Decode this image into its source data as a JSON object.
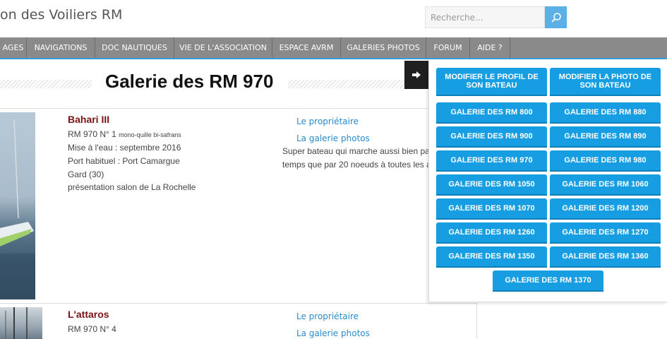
{
  "header": {
    "site_title": "on des Voiliers RM",
    "search_placeholder": "Recherche..."
  },
  "nav": {
    "items": [
      "AGES",
      "NAVIGATIONS",
      "DOC NAUTIQUES",
      "VIE DE L'ASSOCIATION",
      "ESPACE AVRM",
      "GALERIES PHOTOS",
      "FORUM",
      "AIDE ?"
    ]
  },
  "page": {
    "title": "Galerie des RM 970"
  },
  "boats": [
    {
      "name": "Bahari III",
      "model": "RM 970 N° 1",
      "model_note": "mono-quille bi-safrans",
      "launch": "Mise à l'eau : septembre 2016",
      "port": "Port habituel : Port Camargue",
      "region": "Gard (30)",
      "extra": "présentation salon de La Rochelle",
      "link_owner": "Le propriétaire",
      "link_gallery": "La galerie photos",
      "desc1": "Super bateau qui marche aussi bien par",
      "desc2": "temps que par 20 noeuds à toutes les al"
    },
    {
      "name": "L'attaros",
      "model": "RM 970 N° 4",
      "link_owner": "Le propriétaire",
      "link_gallery": "La galerie photos"
    }
  ],
  "panel": {
    "buttons": [
      "MODIFIER LE PROFIL DE SON BATEAU",
      "MODIFIER LA PHOTO DE SON BATEAU",
      "GALERIE DES RM 800",
      "GALERIE DES RM 880",
      "GALERIE DES RM 900",
      "GALERIE DES RM 890",
      "GALERIE DES RM 970",
      "GALERIE DES RM 980",
      "GALERIE DES RM 1050",
      "GALERIE DES RM 1060",
      "GALERIE DES RM 1070",
      "GALERIE DES RM 1200",
      "GALERIE DES RM 1260",
      "GALERIE DES RM 1270",
      "GALERIE DES RM 1350",
      "GALERIE DES RM 1360",
      "GALERIE DES RM 1370"
    ]
  },
  "colors": {
    "accent": "#179ee2",
    "nav_bg": "#8a8a8a",
    "boat_name": "#7a1414",
    "link": "#2a8bcf"
  }
}
